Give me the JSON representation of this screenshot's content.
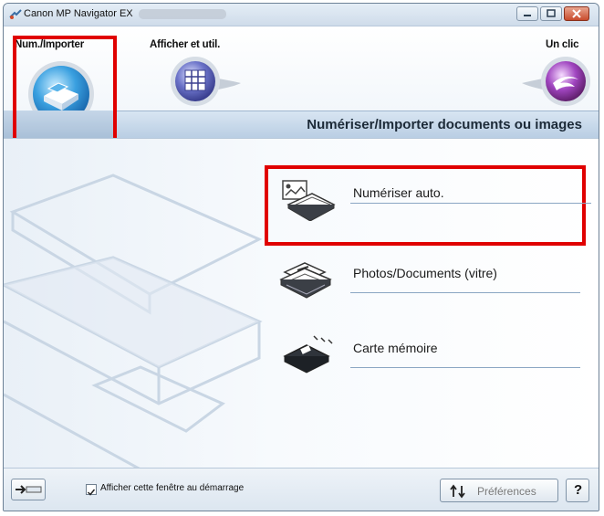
{
  "window": {
    "title": "Canon MP Navigator EX"
  },
  "modes": [
    {
      "label": "Num./Importer",
      "icon": "scanner-icon",
      "selected": true
    },
    {
      "label": "Afficher et util.",
      "icon": "grid-view-icon",
      "selected": false
    },
    {
      "label": "Un clic",
      "icon": "one-click-icon",
      "selected": false
    }
  ],
  "header": {
    "title": "Numériser/Importer documents ou images"
  },
  "items": [
    {
      "label": "Numériser auto.",
      "icon": "auto-scan-icon",
      "highlighted": true
    },
    {
      "label": "Photos/Documents (vitre)",
      "icon": "platen-photos-icon",
      "highlighted": false
    },
    {
      "label": "Carte mémoire",
      "icon": "memory-card-icon",
      "highlighted": false
    }
  ],
  "footer": {
    "show_on_startup_label": "Afficher cette fenêtre au démarrage",
    "show_on_startup_checked": true,
    "preferences_label": "Préférences",
    "help_label": "?"
  },
  "colors": {
    "highlight": "#e00000",
    "band": "#b8cde3"
  }
}
